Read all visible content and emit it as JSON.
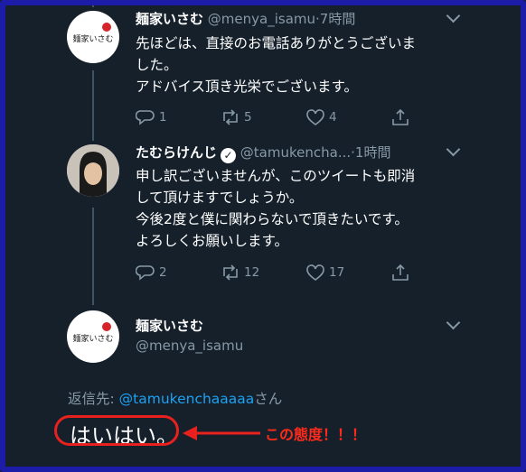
{
  "tweets": [
    {
      "name": "麺家いさむ",
      "handle": "@menya_isamu",
      "time": "·7時間",
      "text": "先ほどは、直接のお電話ありがとうございま\nした。\nアドバイス頂き光栄でございます。",
      "reply_count": "1",
      "retweet_count": "5",
      "like_count": "4"
    },
    {
      "name": "たむらけんじ",
      "handle": "@tamukencha...",
      "time": "·1時間",
      "text": "申し訳ございませんが、このツイートも即消\nして頂けますでしょうか。\n今後2度と僕に関わらないで頂きたいです。\nよろしくお願いします。",
      "reply_count": "2",
      "retweet_count": "12",
      "like_count": "17"
    }
  ],
  "main_tweet": {
    "name": "麺家いさむ",
    "handle": "@menya_isamu",
    "reply_to_prefix": "返信先: ",
    "reply_to_handle": "@tamukenchaaaaa",
    "reply_to_suffix": "さん",
    "text": "はいはい。"
  },
  "annotation": {
    "text": "この態度！！！",
    "color": "#ff2a1a"
  },
  "avatar_logo_text": "麺家いさむ",
  "colors": {
    "background": "#15202b",
    "secondary_text": "#8899a6",
    "link": "#1da1f2",
    "annotation_red": "#e8201e",
    "frame_blue": "#1c1ca8"
  },
  "icons": [
    "reply-icon",
    "retweet-icon",
    "like-icon",
    "share-icon",
    "verified-badge-icon",
    "chevron-down-icon"
  ]
}
